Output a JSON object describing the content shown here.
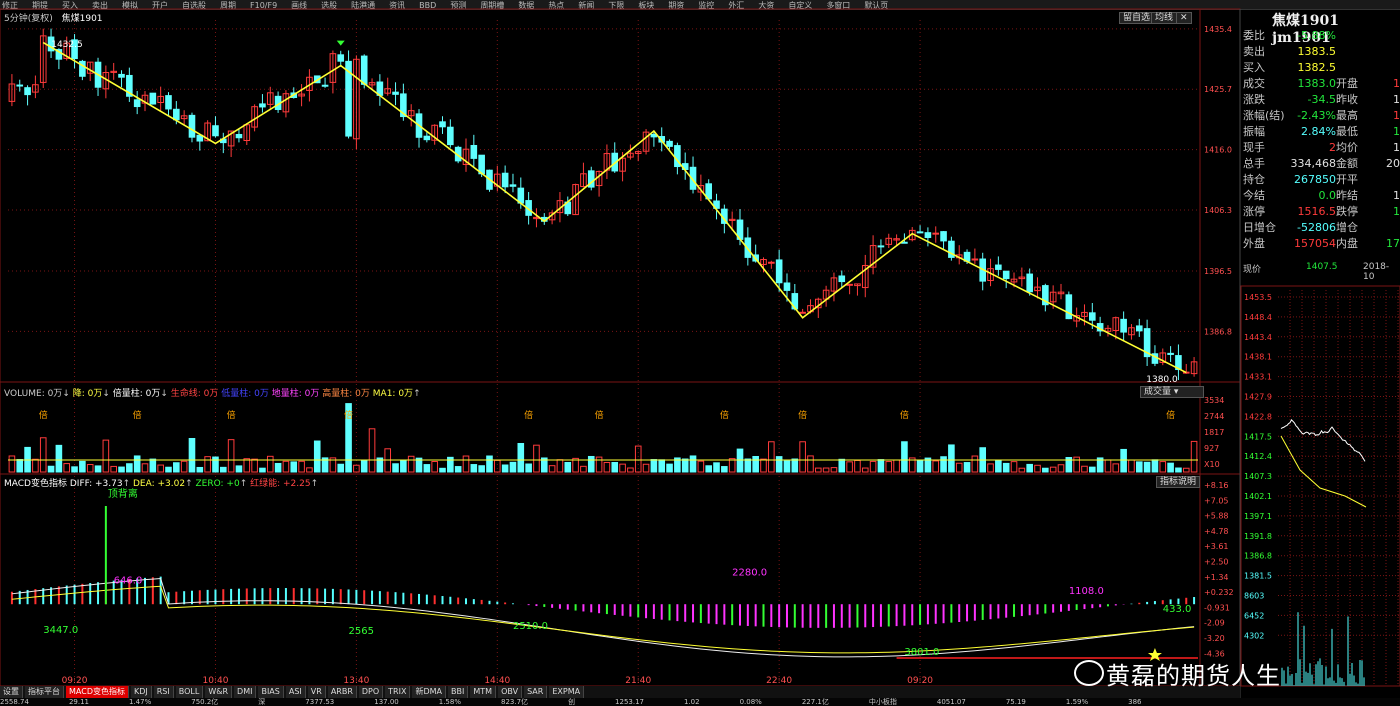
{
  "toolbar": [
    "修正",
    "期提",
    "买入",
    "卖出",
    "模拟",
    "开户",
    "自选股",
    "周期",
    "F10/F9",
    "画线",
    "选股",
    "陆港通",
    "资讯",
    "BBD",
    "预测",
    "周期槽",
    "数据",
    "热点",
    "新闻",
    "下限",
    "板块",
    "期资",
    "监控",
    "外汇",
    "大资",
    "自定义",
    "多窗口",
    "默认页"
  ],
  "chart_header": {
    "period": "5分钟(复权)",
    "symbol": "焦煤1901"
  },
  "chart_buttons": {
    "zoom": "留自选",
    "avg": "均线",
    "close": "✕"
  },
  "volume_header": {
    "volume": "VOLUME: 0万",
    "down": "降: 0万",
    "double": "倍量柱: 0万",
    "lifeline": "生命线: 0万",
    "lowvol": "低量柱: 0万",
    "flag": "地量柱: 0万",
    "highvol": "高量柱: 0万",
    "ma1": "MA1: 0万"
  },
  "volume_button": "成交量",
  "macd_header": {
    "name": "MACD变色指标",
    "diff": "DIFF: +3.73",
    "dea": "DEA: +3.02",
    "zero": "ZERO: +0",
    "red": "红绿能: +2.25"
  },
  "macd_button": "指标说明",
  "info": {
    "title": "焦煤1901 jm1901",
    "rows": [
      {
        "l": "委比",
        "v": "-5.88%",
        "vc": "green",
        "l2": "",
        "v2": "",
        "v2c": "white"
      },
      {
        "l": "卖出",
        "v": "1383.5",
        "vc": "yellow",
        "l2": "",
        "v2": "",
        "v2c": "white"
      },
      {
        "l": "买入",
        "v": "1382.5",
        "vc": "yellow",
        "l2": "",
        "v2": "",
        "v2c": "white"
      },
      {
        "l": "成交",
        "v": "1383.0",
        "vc": "green",
        "l2": "开盘",
        "v2": "1",
        "v2c": "red"
      },
      {
        "l": "涨跌",
        "v": "-34.5",
        "vc": "green",
        "l2": "昨收",
        "v2": "1",
        "v2c": "white"
      },
      {
        "l": "涨幅(结)",
        "v": "-2.43%",
        "vc": "green",
        "l2": "最高",
        "v2": "1",
        "v2c": "red"
      },
      {
        "l": "振幅",
        "v": "2.84%",
        "vc": "cyan",
        "l2": "最低",
        "v2": "1",
        "v2c": "green"
      },
      {
        "l": "现手",
        "v": "2",
        "vc": "red",
        "l2": "均价",
        "v2": "1",
        "v2c": "white"
      },
      {
        "l": "总手",
        "v": "334,468",
        "vc": "white",
        "l2": "金额",
        "v2": "20",
        "v2c": "white"
      },
      {
        "l": "持仓",
        "v": "267850",
        "vc": "cyan",
        "l2": "开平",
        "v2": "",
        "v2c": "white"
      },
      {
        "l": "今结",
        "v": "0.0",
        "vc": "green",
        "l2": "昨结",
        "v2": "1",
        "v2c": "white"
      },
      {
        "l": "涨停",
        "v": "1516.5",
        "vc": "red",
        "l2": "跌停",
        "v2": "1",
        "v2c": "green"
      },
      {
        "l": "日增仓",
        "v": "-52806",
        "vc": "cyan",
        "l2": "增仓",
        "v2": "",
        "v2c": "white"
      },
      {
        "l": "外盘",
        "v": "157054",
        "vc": "red",
        "l2": "内盘",
        "v2": "17",
        "v2c": "green"
      }
    ],
    "now_label": "现价",
    "now_value": "1407.5",
    "now_date": "2018-10"
  },
  "tabs": [
    "设置",
    "指标平台",
    "MACD变色指标",
    "KDJ",
    "RSI",
    "BOLL",
    "W&R",
    "DMI",
    "BIAS",
    "ASI",
    "VR",
    "ARBR",
    "DPO",
    "TRIX",
    "新DMA",
    "BBI",
    "MTM",
    "OBV",
    "SAR",
    "EXPMA"
  ],
  "bottom": [
    "2558.74",
    "29.11",
    "1.47%",
    "750.2亿",
    "深",
    "7377.53",
    "137.00",
    "1.58%",
    "823.7亿",
    "创",
    "1253.17",
    "1.02",
    "0.08%",
    "227.1亿",
    "中小板指",
    "4051.07",
    "75.19",
    "1.59%",
    "386"
  ],
  "watermark": "黄磊的期货人生",
  "colors": {
    "up": "#ff3b3b",
    "down": "#5fffff",
    "trend": "#ffff33",
    "grid": "#7a1414"
  },
  "chart_data": {
    "type": "candlestick",
    "time_labels": [
      "09:20",
      "10:40",
      "13:40",
      "14:40",
      "21:40",
      "22:40",
      "09:20"
    ],
    "time_label_index": [
      8,
      26,
      44,
      62,
      80,
      98,
      116
    ],
    "price_axis": {
      "ticks": [
        "1435.4",
        "1425.7",
        "1416.0",
        "1406.3",
        "1396.5",
        "1386.8"
      ],
      "ylim": [
        1379,
        1436.5
      ]
    },
    "volume_axis": {
      "ticks": [
        "3534",
        "2744",
        "1817",
        "927",
        "X10"
      ],
      "max": 3534
    },
    "macd_axis": {
      "ticks": [
        "+8.16",
        "+7.05",
        "+5.88",
        "+4.78",
        "+3.61",
        "+2.50",
        "+1.34",
        "+0.232",
        "-0.931",
        "-2.09",
        "-3.20",
        "-4.36"
      ],
      "ylim": [
        -4.9,
        8.4
      ]
    },
    "right_axis": {
      "ticks": [
        "1453.5",
        "1448.4",
        "1443.4",
        "1438.1",
        "1433.1",
        "1427.9",
        "1422.8",
        "1417.5",
        "1412.4",
        "1407.3",
        "1402.1",
        "1397.1",
        "1391.8",
        "1386.8",
        "1381.5",
        "8603",
        "6452",
        "4302"
      ]
    },
    "price_labels": [
      {
        "text": "1432.5",
        "i": 4,
        "p": 1432.5
      },
      {
        "text": "1380.0",
        "i": 150,
        "p": 1380.0
      }
    ],
    "trend_points": [
      [
        4,
        1433.2
      ],
      [
        26,
        1417.0
      ],
      [
        42,
        1429.5
      ],
      [
        68,
        1404.5
      ],
      [
        82,
        1419.0
      ],
      [
        101,
        1389.0
      ],
      [
        115,
        1402.5
      ],
      [
        150,
        1380.2
      ]
    ],
    "macd_labels": [
      {
        "text": "646.0",
        "i": 13,
        "v": 1.6
      },
      {
        "text": "3447.0",
        "i": 4,
        "v": -2.2
      },
      {
        "text": "2565",
        "i": 43,
        "v": -2.3
      },
      {
        "text": "2510.0",
        "i": 64,
        "v": -1.9
      },
      {
        "text": "2280.0",
        "i": 92,
        "v": 2.2
      },
      {
        "text": "3801.0",
        "i": 114,
        "v": -3.9
      },
      {
        "text": "1108.0",
        "i": 135,
        "v": 0.8
      },
      {
        "text": "433.0",
        "i": 147,
        "v": -0.6
      }
    ],
    "divergence_label": "顶背离",
    "seed": 1901
  }
}
